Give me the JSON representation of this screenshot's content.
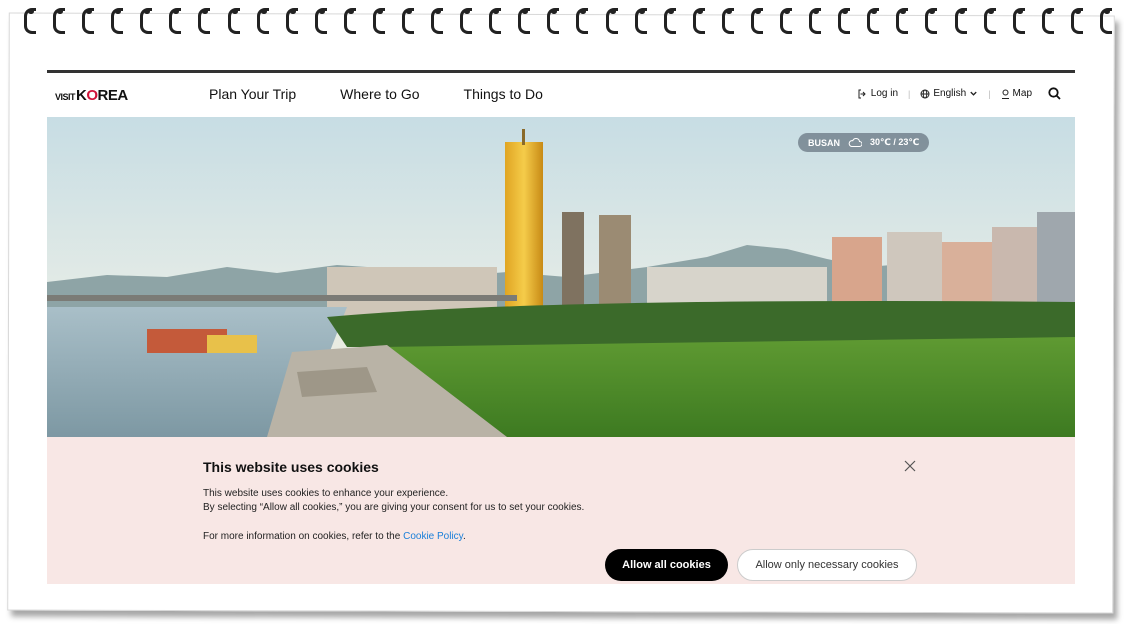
{
  "brand": {
    "logo_small": "VISIT",
    "logo_main_left": "K",
    "logo_main_o": "O",
    "logo_main_right": "REA"
  },
  "nav": {
    "items": [
      {
        "label": "Plan Your Trip"
      },
      {
        "label": "Where to Go"
      },
      {
        "label": "Things to Do"
      }
    ]
  },
  "utility": {
    "login_label": "Log in",
    "language_label": "English",
    "map_label": "Map"
  },
  "hero": {
    "weather_city": "BUSAN",
    "weather_temp": "30℃ / 23℃"
  },
  "cookie_banner": {
    "title": "This website uses cookies",
    "line1": "This website uses cookies to enhance your experience.",
    "line2": "By selecting “Allow all cookies,” you are giving your consent for us to set your cookies.",
    "policy_prefix": "For more information on cookies, refer to the ",
    "policy_link": "Cookie Policy",
    "policy_suffix": ".",
    "allow_all_label": "Allow all cookies",
    "allow_necessary_label": "Allow only necessary cookies"
  },
  "colors": {
    "accent_red": "#d0143a",
    "banner_bg": "#f8e7e5",
    "link_blue": "#1a7fd9"
  }
}
